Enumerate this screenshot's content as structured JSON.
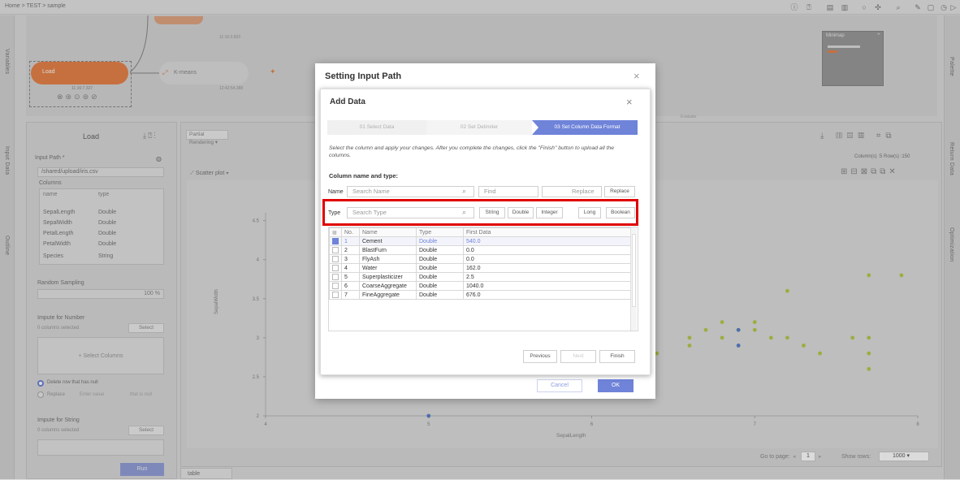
{
  "topbar": {
    "breadcrumb": "Home > TEST > sample",
    "icons": [
      "info-icon",
      "help-icon",
      "copy-icon",
      "save-icon",
      "circle-icon",
      "move-icon",
      "zoom-icon",
      "brush-icon",
      "file-icon",
      "clock-icon",
      "trash-icon",
      "calendar-icon",
      "play-icon"
    ]
  },
  "side_tabs": {
    "left": [
      "Variables",
      "Input Data",
      "Outline"
    ],
    "right": [
      "Palette",
      "Return Data",
      "Optimization"
    ]
  },
  "workflow": {
    "nodes": [
      {
        "label": "Load",
        "time": "11:16:7.327"
      },
      {
        "label": "K-means",
        "time": "12:42:54.388"
      }
    ],
    "top_time": "11:16:3.833",
    "extra_text": "Evaluate"
  },
  "minimap": {
    "title": "Minimap"
  },
  "load_panel": {
    "title": "Load",
    "input_path_label": "Input Path *",
    "input_path_value": "/shared/upload/iris.csv",
    "columns_label": "Columns",
    "col_headers": [
      "name",
      "type"
    ],
    "columns": [
      [
        "SepalLength",
        "Double"
      ],
      [
        "SepalWidth",
        "Double"
      ],
      [
        "PetalLength",
        "Double"
      ],
      [
        "PetalWidth",
        "Double"
      ],
      [
        "Species",
        "String"
      ]
    ],
    "random_sampling": "Random Sampling",
    "sampling_value": "100 %",
    "impute_number": "Impute for Number",
    "selected_count_1": "0 columns selected",
    "select_btn": "Select",
    "select_columns": "+ Select Columns",
    "delete_null": "Delete row that has null",
    "replace": "Replace",
    "enter_value": "Enter value",
    "that_is_null": "that is null",
    "impute_string": "Impute for String",
    "selected_count_2": "0 columns selected",
    "run": "Run"
  },
  "chart_panel": {
    "partial_rendering": "Partial Rendering",
    "scatter_plot": "Scatter plot",
    "columns_rows": "Column(s) :5   Row(s) :150",
    "go_to_page": "Go to page:",
    "page": "1",
    "show_rows": "Show rows:",
    "rows_value": "1000",
    "table_tab": "table"
  },
  "chart_data": {
    "type": "scatter",
    "xlabel": "SepalLength",
    "ylabel": "SepalWidth",
    "x_ticks": [
      "4",
      "5",
      "6",
      "7",
      "8"
    ],
    "y_ticks": [
      "2",
      "2.5",
      "3",
      "3.5",
      "4",
      "4.5"
    ],
    "xlim": [
      4,
      8
    ],
    "ylim": [
      2,
      4.6
    ],
    "series": [
      {
        "color": "#b8c94a",
        "points": [
          [
            7.7,
            3.8
          ],
          [
            7.9,
            3.8
          ],
          [
            7.2,
            3.6
          ],
          [
            6.9,
            3.1
          ],
          [
            7.0,
            3.2
          ],
          [
            7.1,
            3.0
          ],
          [
            6.8,
            3.0
          ],
          [
            7.2,
            3.0
          ],
          [
            6.7,
            3.1
          ],
          [
            7.0,
            3.1
          ],
          [
            7.4,
            2.8
          ],
          [
            7.6,
            3.0
          ],
          [
            7.7,
            3.0
          ],
          [
            7.3,
            2.9
          ],
          [
            7.7,
            2.8
          ],
          [
            7.7,
            2.6
          ],
          [
            6.8,
            3.2
          ],
          [
            6.6,
            3.0
          ],
          [
            6.4,
            2.8
          ],
          [
            6.6,
            2.9
          ]
        ]
      },
      {
        "color": "#5b82c8",
        "points": [
          [
            6.9,
            3.1
          ],
          [
            6.9,
            2.9
          ],
          [
            5.0,
            2.0
          ]
        ]
      }
    ]
  },
  "outer_dialog": {
    "title": "Setting Input Path",
    "cancel": "Cancel",
    "ok": "OK"
  },
  "inner_dialog": {
    "title": "Add Data",
    "steps": [
      "01 Select Data",
      "02 Set Delimiter",
      "03 Set Column Data Format"
    ],
    "instruction": "Select the column and apply your changes. After you complete the changes, click the \"Finish\" button to upload all the columns.",
    "section_label": "Column name and type:",
    "name_label": "Name",
    "search_name_placeholder": "Search Name",
    "find_placeholder": "Find",
    "replace_placeholder": "Replace",
    "replace_btn": "Replace",
    "type_label": "Type",
    "search_type_placeholder": "Search Type",
    "type_buttons": [
      "String",
      "Double",
      "Integer",
      "Long",
      "Boolean"
    ],
    "table_headers": [
      "No.",
      "Name",
      "Type",
      "First Data"
    ],
    "rows": [
      {
        "no": "1",
        "name": "Cement",
        "type": "Double",
        "first": "540.0",
        "checked": true
      },
      {
        "no": "2",
        "name": "BlastFurn",
        "type": "Double",
        "first": "0.0",
        "checked": false
      },
      {
        "no": "3",
        "name": "FlyAsh",
        "type": "Double",
        "first": "0.0",
        "checked": false
      },
      {
        "no": "4",
        "name": "Water",
        "type": "Double",
        "first": "162.0",
        "checked": false
      },
      {
        "no": "5",
        "name": "Superplasticizer",
        "type": "Double",
        "first": "2.5",
        "checked": false
      },
      {
        "no": "6",
        "name": "CoarseAggregate",
        "type": "Double",
        "first": "1040.0",
        "checked": false
      },
      {
        "no": "7",
        "name": "FineAggregate",
        "type": "Double",
        "first": "676.0",
        "checked": false
      }
    ],
    "previous": "Previous",
    "next": "Next",
    "finish": "Finish"
  },
  "colors": {
    "accent": "#6f83d9",
    "load_node": "#e8834a",
    "highlight": "#e00000"
  }
}
